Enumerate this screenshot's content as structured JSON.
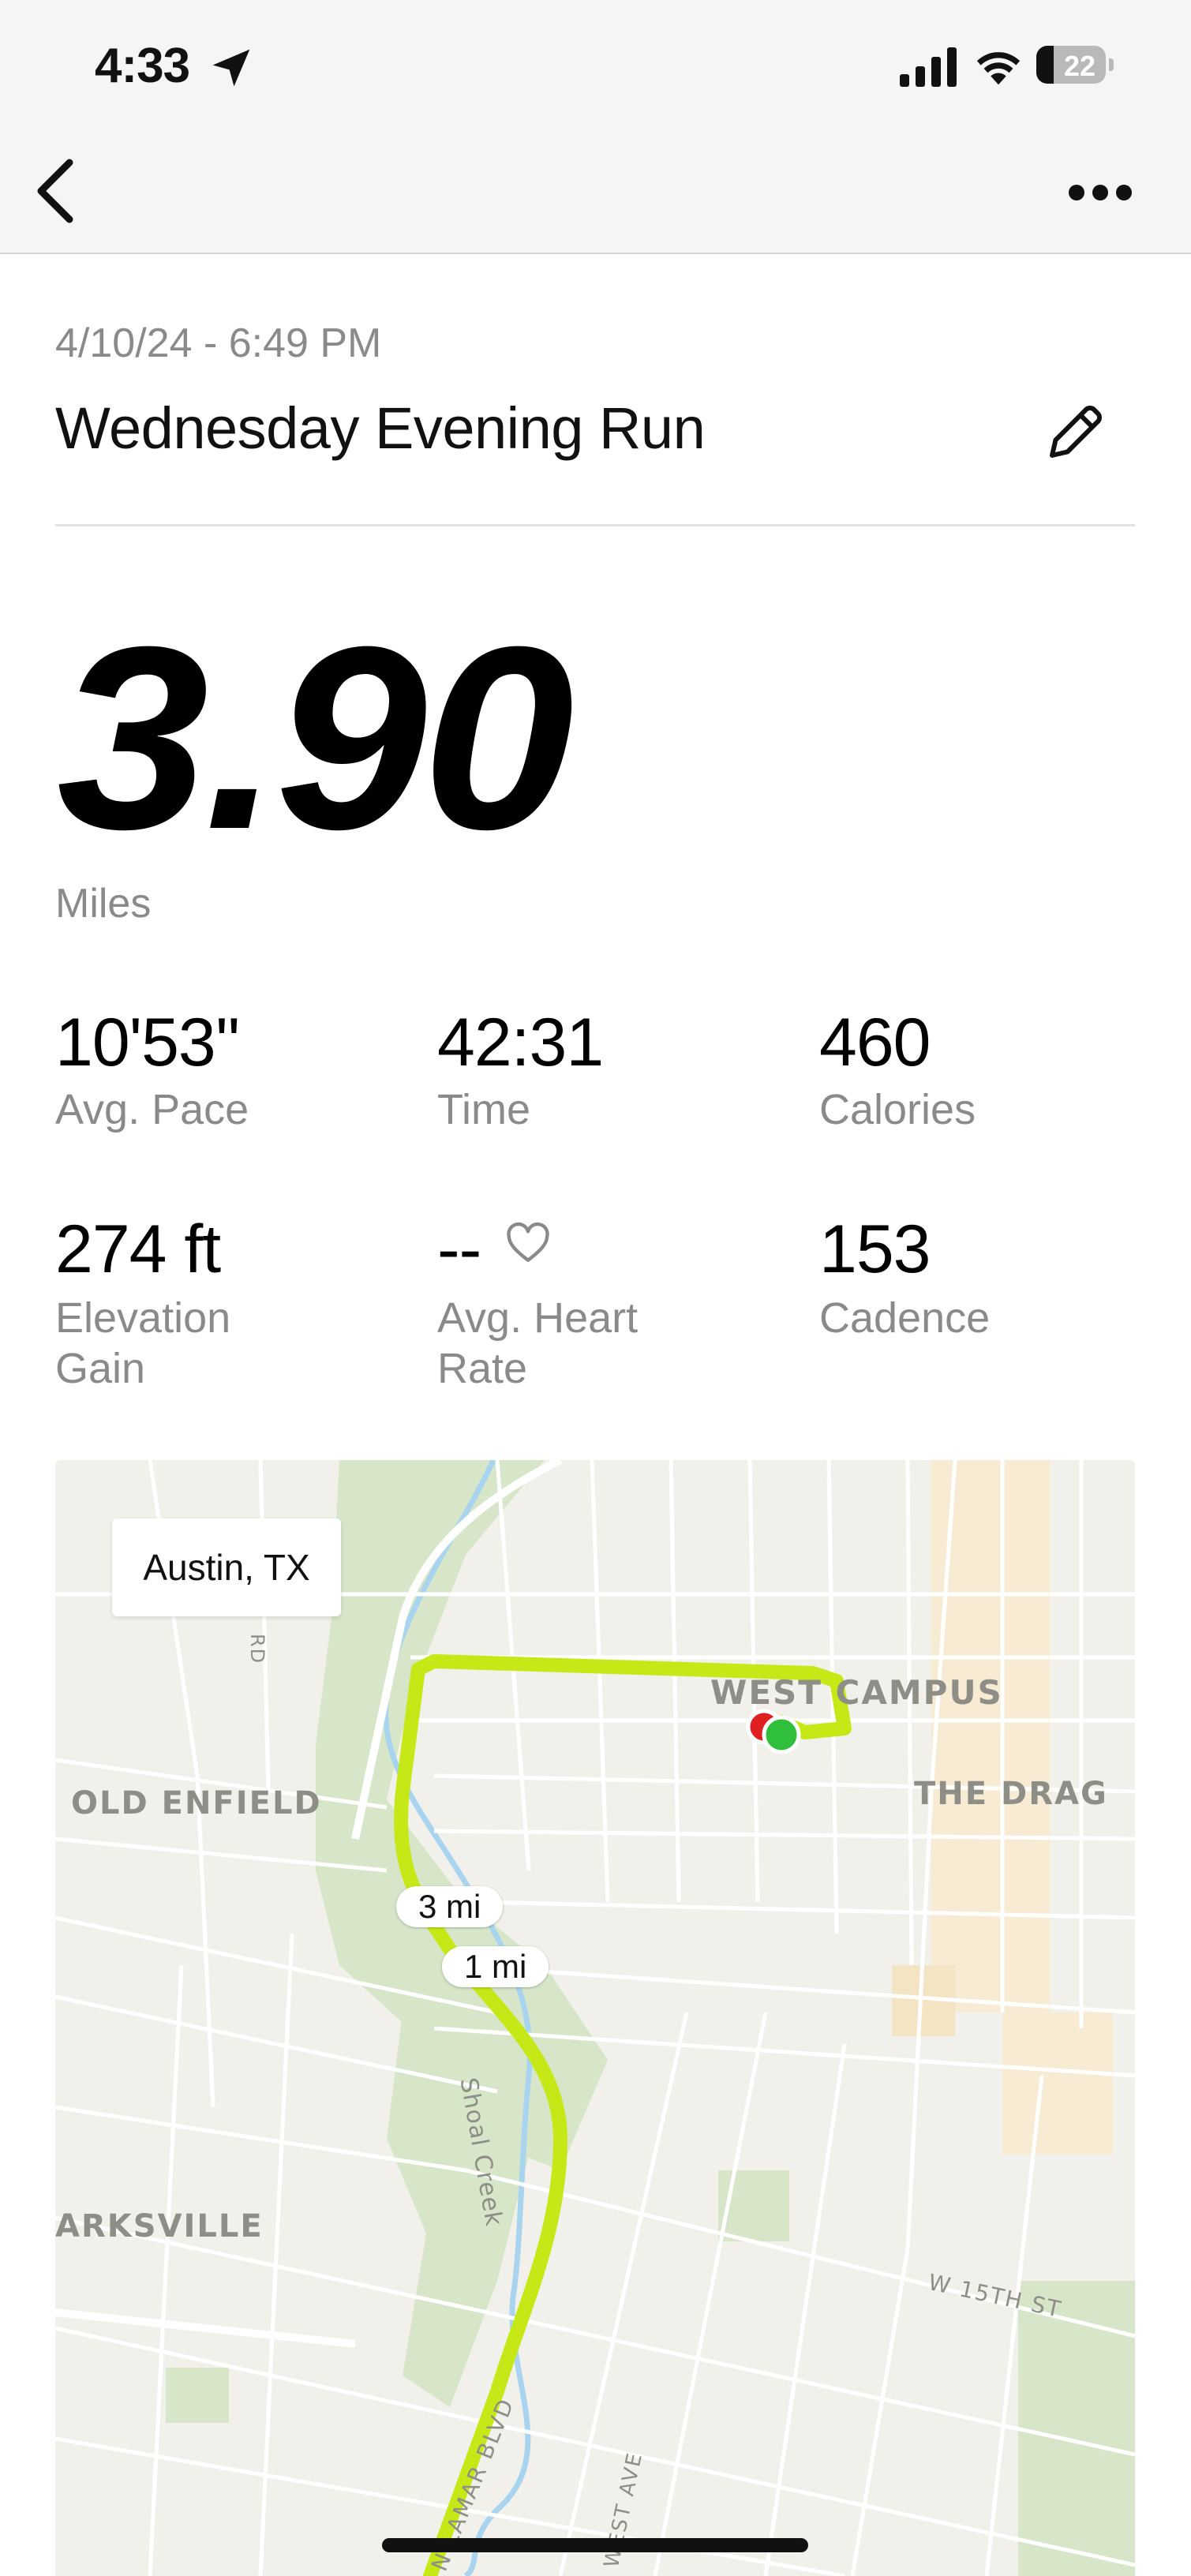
{
  "status_bar": {
    "time": "4:33",
    "battery_percent": "22"
  },
  "activity": {
    "date": "4/10/24 - 6:49 PM",
    "title": "Wednesday Evening Run",
    "distance": "3.90",
    "distance_unit": "Miles"
  },
  "stats": {
    "pace": {
      "value": "10'53''",
      "label": "Avg. Pace"
    },
    "time": {
      "value": "42:31",
      "label": "Time"
    },
    "calories": {
      "value": "460",
      "label": "Calories"
    },
    "elevation": {
      "value": "274 ft",
      "label_line1": "Elevation",
      "label_line2": "Gain"
    },
    "heart_rate": {
      "value": "--",
      "label_line1": "Avg. Heart",
      "label_line2": "Rate"
    },
    "cadence": {
      "value": "153",
      "label": "Cadence"
    }
  },
  "map": {
    "city": "Austin, TX",
    "labels": {
      "west_campus": "WEST CAMPUS",
      "the_drag": "THE DRAG",
      "old_enfield": "OLD ENFIELD",
      "clarksville": "ARKSVILLE",
      "shoal_creek": "Shoal Creek",
      "w15th": "W 15TH ST",
      "lamar": "N LAMAR BLVD",
      "west_ave": "WEST AVE",
      "rd": "RD"
    },
    "mile_markers": [
      "3 mi",
      "1 mi"
    ],
    "colors": {
      "route": "#c6e817",
      "start": "#2fbf3a",
      "end": "#e02020",
      "park": "#d7e6c8",
      "water": "#a9d4ef"
    }
  }
}
